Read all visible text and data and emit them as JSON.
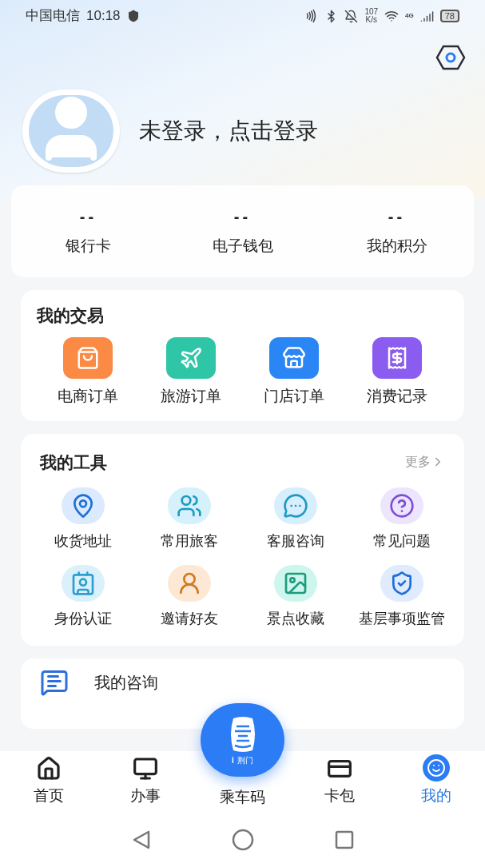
{
  "status_bar": {
    "carrier": "中国电信",
    "time": "10:18",
    "speed_value": "107",
    "speed_unit": "K/s",
    "network": "4G",
    "battery": "78"
  },
  "profile": {
    "login_prompt": "未登录，点击登录"
  },
  "stats": [
    {
      "value": "--",
      "label": "银行卡"
    },
    {
      "value": "--",
      "label": "电子钱包"
    },
    {
      "value": "--",
      "label": "我的积分"
    }
  ],
  "my_trades": {
    "title": "我的交易",
    "items": [
      {
        "label": "电商订单",
        "color": "#fb8a45"
      },
      {
        "label": "旅游订单",
        "color": "#2fc6a8"
      },
      {
        "label": "门店订单",
        "color": "#2b86f5"
      },
      {
        "label": "消费记录",
        "color": "#8b5cf0"
      }
    ]
  },
  "my_tools": {
    "title": "我的工具",
    "more": "更多",
    "items": [
      {
        "label": "收货地址",
        "color": "#dbeafe"
      },
      {
        "label": "常用旅客",
        "color": "#d5f1fb"
      },
      {
        "label": "客服咨询",
        "color": "#d7eefc"
      },
      {
        "label": "常见问题",
        "color": "#ede4fd"
      },
      {
        "label": "身份认证",
        "color": "#daf0fb"
      },
      {
        "label": "邀请好友",
        "color": "#fde8d6"
      },
      {
        "label": "景点收藏",
        "color": "#cdf6ef"
      },
      {
        "label": "基层事项监管",
        "color": "#e0ecfd"
      }
    ]
  },
  "consult": {
    "title": "我的咨询"
  },
  "center_button": {
    "badge": "i",
    "city": "荆门"
  },
  "tab_bar": [
    {
      "label": "首页",
      "selected": false
    },
    {
      "label": "办事",
      "selected": false
    },
    {
      "label": "乘车码",
      "selected": false,
      "kind": "center"
    },
    {
      "label": "卡包",
      "selected": false
    },
    {
      "label": "我的",
      "selected": true
    }
  ]
}
